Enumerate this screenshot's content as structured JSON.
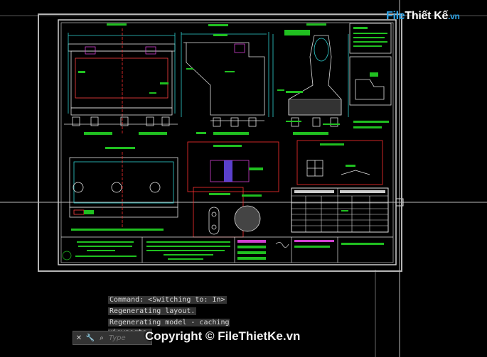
{
  "logo": {
    "part1": "File",
    "part2": "Thiết Kế",
    "part3": ".vn"
  },
  "command_history": [
    "Command:   <Switching to: In>",
    "Regenerating layout.",
    "Regenerating model - caching viewports."
  ],
  "command_line": {
    "placeholder": "Type"
  },
  "watermark": "Copyright © FileThietKe.vn",
  "icons": [
    "close-icon",
    "wrench-icon",
    "search-icon"
  ]
}
